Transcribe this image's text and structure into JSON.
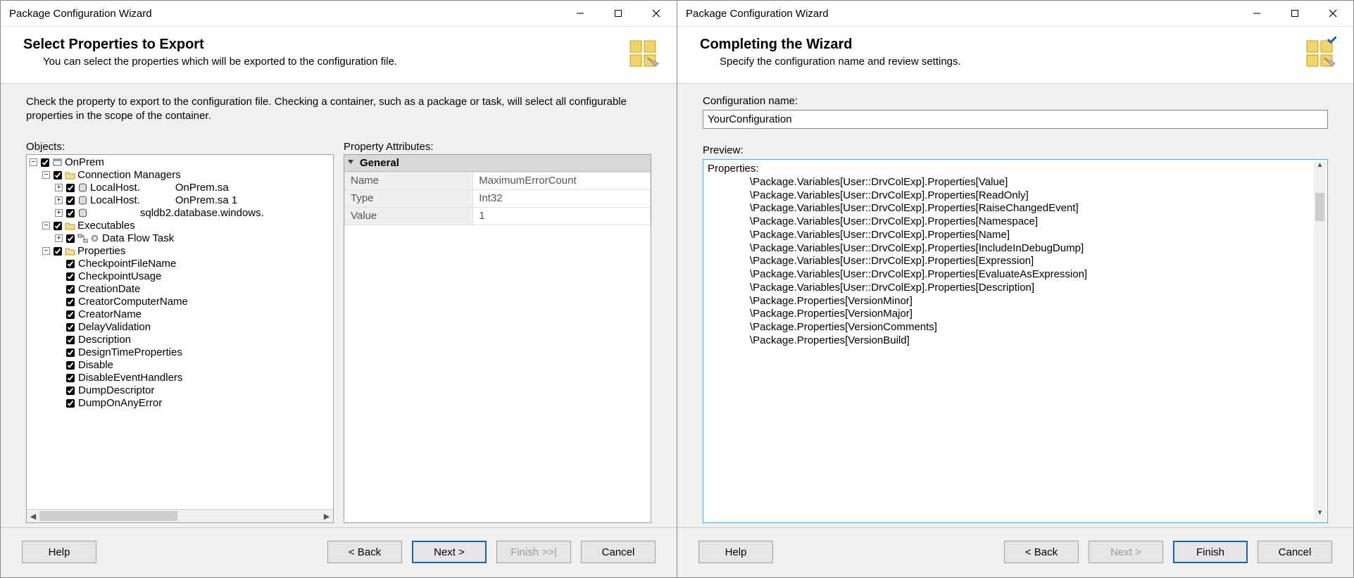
{
  "left": {
    "window_title": "Package Configuration Wizard",
    "heading": "Select Properties to Export",
    "subheading": "You can select the properties which will be exported to the configuration file.",
    "instructions": "Check the property to export to the configuration file. Checking a container, such as a package or task, will select all configurable properties in the scope of the container.",
    "objects_label": "Objects:",
    "attributes_label": "Property Attributes:",
    "tree": {
      "root": "OnPrem",
      "conn_mgr": "Connection Managers",
      "conn1_a": "LocalHost.",
      "conn1_b": "OnPrem.sa",
      "conn2_a": "LocalHost.",
      "conn2_b": "OnPrem.sa 1",
      "conn3_b": "sqldb2.database.windows.",
      "executables": "Executables",
      "dft": "Data Flow Task",
      "properties": "Properties",
      "props": [
        "CheckpointFileName",
        "CheckpointUsage",
        "CreationDate",
        "CreatorComputerName",
        "CreatorName",
        "DelayValidation",
        "Description",
        "DesignTimeProperties",
        "Disable",
        "DisableEventHandlers",
        "DumpDescriptor",
        "DumpOnAnyError"
      ]
    },
    "propgrid": {
      "group": "General",
      "rows": [
        {
          "k": "Name",
          "v": "MaximumErrorCount"
        },
        {
          "k": "Type",
          "v": "Int32"
        },
        {
          "k": "Value",
          "v": "1"
        }
      ]
    },
    "buttons": {
      "help": "Help",
      "back": "< Back",
      "next": "Next >",
      "finish": "Finish >>|",
      "cancel": "Cancel"
    }
  },
  "right": {
    "window_title": "Package Configuration Wizard",
    "heading": "Completing the Wizard",
    "subheading": "Specify the configuration name and review settings.",
    "config_name_label": "Configuration name:",
    "config_name_value": "YourConfiguration",
    "preview_label": "Preview:",
    "preview_header": "Properties:",
    "preview_lines": [
      "\\Package.Variables[User::DrvColExp].Properties[Value]",
      "\\Package.Variables[User::DrvColExp].Properties[ReadOnly]",
      "\\Package.Variables[User::DrvColExp].Properties[RaiseChangedEvent]",
      "\\Package.Variables[User::DrvColExp].Properties[Namespace]",
      "\\Package.Variables[User::DrvColExp].Properties[Name]",
      "\\Package.Variables[User::DrvColExp].Properties[IncludeInDebugDump]",
      "\\Package.Variables[User::DrvColExp].Properties[Expression]",
      "\\Package.Variables[User::DrvColExp].Properties[EvaluateAsExpression]",
      "\\Package.Variables[User::DrvColExp].Properties[Description]",
      "\\Package.Properties[VersionMinor]",
      "\\Package.Properties[VersionMajor]",
      "\\Package.Properties[VersionComments]",
      "\\Package.Properties[VersionBuild]"
    ],
    "buttons": {
      "help": "Help",
      "back": "< Back",
      "next": "Next >",
      "finish": "Finish",
      "cancel": "Cancel"
    }
  }
}
